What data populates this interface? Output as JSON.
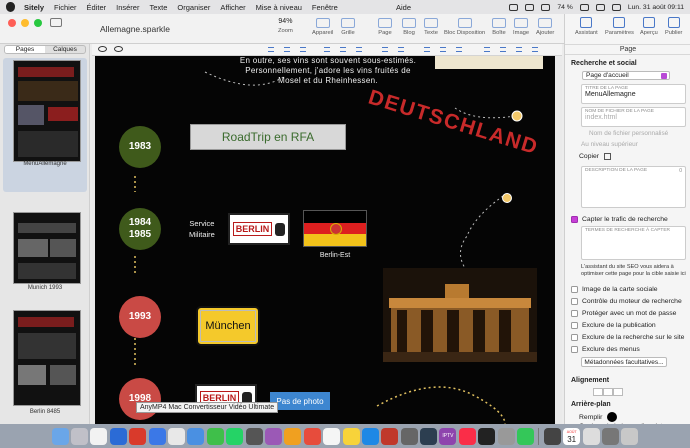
{
  "menubar": {
    "app_name": "Sitely",
    "items": [
      "Fichier",
      "Éditer",
      "Insérer",
      "Texte",
      "Organiser",
      "Afficher",
      "Mise à niveau",
      "Fenêtre"
    ],
    "help": "Aide",
    "battery": "74 %",
    "clock": "Lun. 31 août  09:11"
  },
  "window": {
    "title": "Allemagne.sparkle",
    "zoom_value": "94%",
    "toolbar": [
      "Zoom",
      "Appareil",
      "Grille",
      "Page",
      "Blog",
      "Texte",
      "Bloc Disposition",
      "Boîte",
      "Image",
      "Ajouter"
    ]
  },
  "sidebar": {
    "tabs": [
      "Pages",
      "Calques"
    ],
    "pages": [
      {
        "label": "MenuAllemagne",
        "selected": true
      },
      {
        "label": "Munich 1993",
        "selected": false
      },
      {
        "label": "Berlin 8485",
        "selected": false
      }
    ]
  },
  "canvas": {
    "intro_lines": [
      "En outre, ses vins sont souvent sous-estimés.",
      "Personnellement, j'adore les vins fruités de",
      "Mosel et du Rheinhessen."
    ],
    "deutschland_stamp": "DEUTSCHLAND",
    "timeline": [
      {
        "year": "1983",
        "color": "#3f5a1b"
      },
      {
        "year": "1984\n1985",
        "color": "#3f5a1b"
      },
      {
        "year": "1993",
        "color": "#c94a45"
      },
      {
        "year": "1998",
        "color": "#c94a45"
      }
    ],
    "roadtrip_button": "RoadTrip en RFA",
    "service_text": "Service\nMilitaire",
    "berlin_sign": "BERLIN",
    "berlin_est": "Berlin-Est",
    "munchen_sign": "München",
    "photo_button": "Pas de photo",
    "colors": {
      "flag_black": "#000000",
      "flag_red": "#dd1f1f",
      "flag_gold": "#f2c21a"
    }
  },
  "tooltip": "AnyMP4 Mac Convertisseur Vidéo Ultimate",
  "inspector": {
    "tools": [
      "Assistant",
      "Paramètres",
      "Aperçu",
      "Publier"
    ],
    "panel_title": "Page",
    "section_seo": "Recherche et social",
    "page_select": "Page d'accueil",
    "title_caption": "TITRE DE LA PAGE",
    "title_value": "MenuAllemagne",
    "filename_caption": "NOM DE FICHIER DE LA PAGE",
    "filename_placeholder": "index.html",
    "custom_filename": "Nom de fichier personnalisé",
    "parent_level": "Au niveau supérieur",
    "copy_label": "Copier",
    "description_caption": "DESCRIPTION DE LA PAGE",
    "description_count": "0",
    "capture_search": "Capter le trafic de recherche",
    "search_terms_caption": "TERMES DE RECHERCHE À CAPTER",
    "assistant_note": "L'assistant du site SEO vous aidera à optimiser cette page pour la cible saisie ici",
    "options": [
      {
        "label": "Image de la carte sociale",
        "checked": false
      },
      {
        "label": "Contrôle du moteur de recherche",
        "checked": false
      },
      {
        "label": "Protéger avec un mot de passe",
        "checked": false
      },
      {
        "label": "Exclure de la publication",
        "checked": false
      },
      {
        "label": "Exclure de la recherche sur le site",
        "checked": false
      },
      {
        "label": "Exclure des menus",
        "checked": false
      }
    ],
    "metadata_button": "Métadonnées facultatives...",
    "alignment_heading": "Alignement",
    "background_heading": "Arrière-plan",
    "fill_label": "Remplir",
    "tabbar_color": "Couleur de la barre d'onglets",
    "fill_color": "#000000"
  },
  "dock": {
    "calendar_month": "AOÛT",
    "calendar_day": "31",
    "iptv_label": "IPTV"
  }
}
